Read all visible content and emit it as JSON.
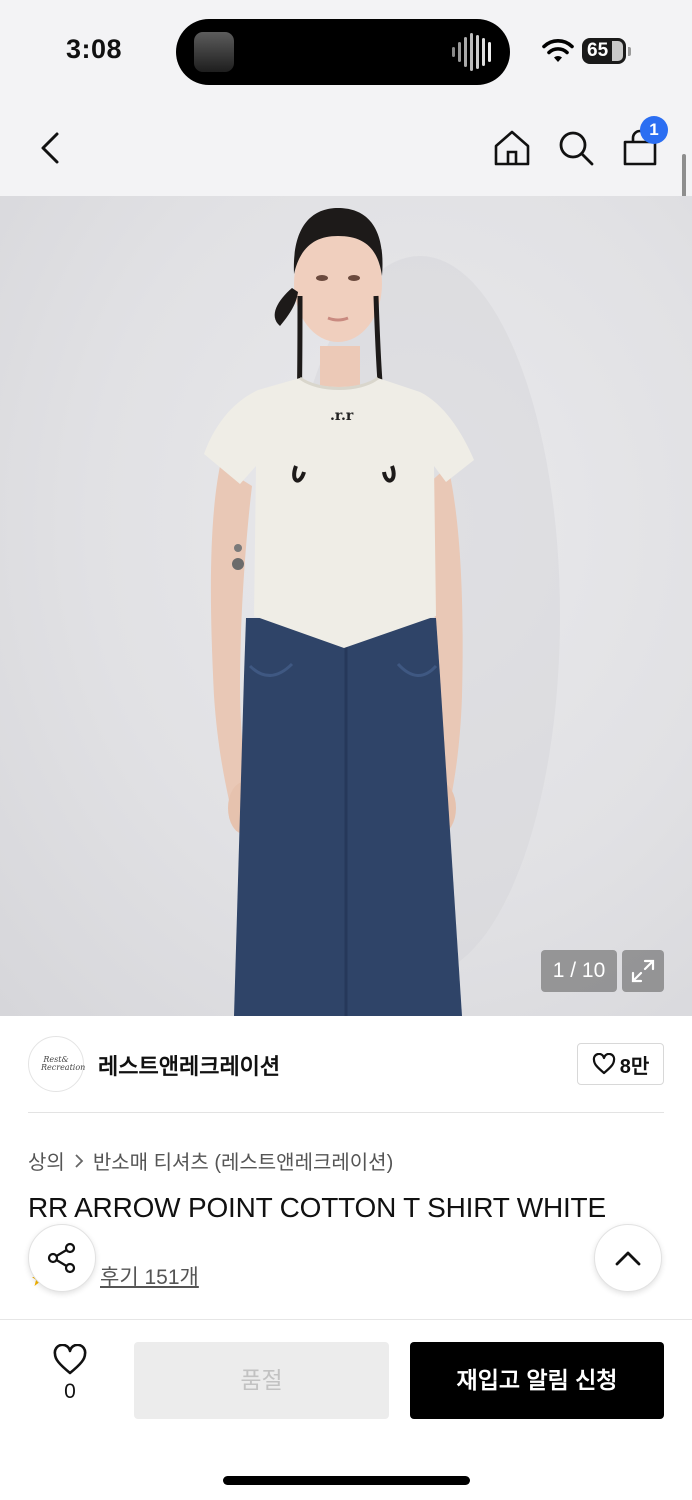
{
  "status_bar": {
    "time": "3:08",
    "battery_level": "65",
    "icons": [
      "wifi-icon",
      "battery-icon"
    ]
  },
  "header": {
    "icons": [
      "back-arrow-icon",
      "home-icon",
      "search-icon",
      "shopping-bag-icon"
    ],
    "cart_badge": "1"
  },
  "gallery": {
    "counter": "1 / 10",
    "expand_icon": "expand-icon",
    "colors": {
      "background": "#e4e4e7",
      "tshirt": "#efede6",
      "jeans": "#2f4468"
    }
  },
  "brand": {
    "logo_text": "Rest& Recreation",
    "name": "레스트앤레크레이션",
    "like_count": "8만"
  },
  "breadcrumb": {
    "items": [
      "상의",
      "반소매 티셔츠 (레스트앤레크레이션)"
    ]
  },
  "product": {
    "title": "RR ARROW POINT COTTON T SHIRT WHITE",
    "reviews": "후기 151개"
  },
  "floating": {
    "share_icon": "share-icon",
    "top_icon": "chevron-up-icon"
  },
  "bottom_bar": {
    "wish_count": "0",
    "soldout_label": "품절",
    "restock_label": "재입고 알림 신청",
    "colors": {
      "primary": "#000000",
      "disabled_bg": "#ececec",
      "badge": "#2b6ef2"
    }
  }
}
